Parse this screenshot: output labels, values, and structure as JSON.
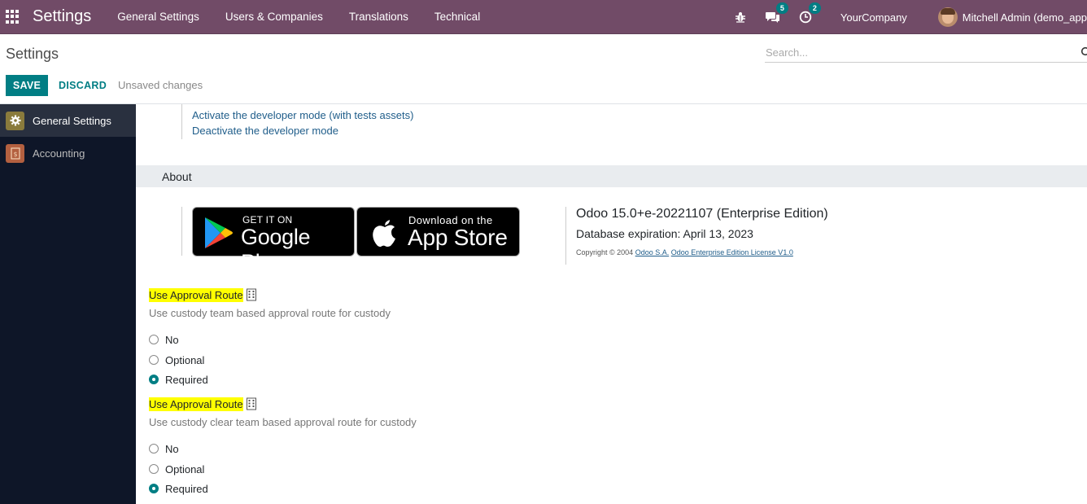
{
  "navbar": {
    "app_title": "Settings",
    "menu": [
      "General Settings",
      "Users & Companies",
      "Translations",
      "Technical"
    ],
    "messages_count": "5",
    "activities_count": "2",
    "company": "YourCompany",
    "user": "Mitchell Admin (demo_app"
  },
  "control": {
    "title": "Settings",
    "search_placeholder": "Search...",
    "save_label": "SAVE",
    "discard_label": "DISCARD",
    "status": "Unsaved changes"
  },
  "sidebar": {
    "items": [
      {
        "label": "General Settings",
        "icon": "gear-icon",
        "active": true,
        "color": "#8a7b3c"
      },
      {
        "label": "Accounting",
        "icon": "accounting-icon",
        "active": false,
        "color": "#b36040"
      }
    ]
  },
  "developer": {
    "links": [
      "Activate the developer mode (with tests assets)",
      "Deactivate the developer mode"
    ]
  },
  "about": {
    "title": "About",
    "google_play_small": "GET IT ON",
    "google_play_big": "Google Play",
    "app_store_small": "Download on the",
    "app_store_big": "App Store",
    "version": "Odoo 15.0+e-20221107 (Enterprise Edition)",
    "expiration": "Database expiration: April 13, 2023",
    "copyright_prefix": "Copyright © 2004 ",
    "copyright_link1": "Odoo S.A.",
    "copyright_sep": " ",
    "copyright_link2": "Odoo Enterprise Edition License V1.0"
  },
  "settings": [
    {
      "label": "Use Approval Route",
      "description": "Use custody team based approval route for custody",
      "options": [
        "No",
        "Optional",
        "Required"
      ],
      "selected": "Required"
    },
    {
      "label": "Use Approval Route",
      "description": "Use custody clear team based approval route for custody",
      "options": [
        "No",
        "Optional",
        "Required"
      ],
      "selected": "Required"
    }
  ],
  "colors": {
    "navbar": "#714b67",
    "accent": "#017e84",
    "sidebar": "#0e1628",
    "highlight": "#ffff00"
  }
}
